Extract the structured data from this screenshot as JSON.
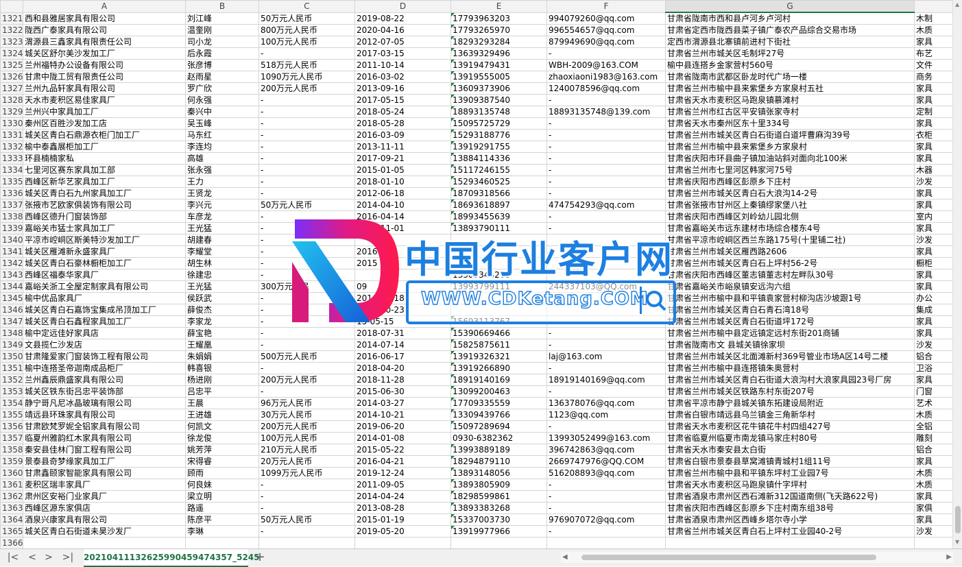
{
  "columns": [
    "A",
    "B",
    "C",
    "D",
    "E",
    "F",
    "G",
    ""
  ],
  "rows": [
    {
      "n": "1321",
      "a": "西和县雅居家具有限公司",
      "b": "刘江峰",
      "c": "50万元人民币",
      "d": "2019-08-22",
      "e": "17793963203",
      "f": "994079260@qq.com",
      "g": "甘肃省陇南市西和县卢河乡卢河村",
      "h": "木制"
    },
    {
      "n": "1322",
      "a": "陇西广泰家具有限公司",
      "b": "温奎刚",
      "c": "800万元人民币",
      "d": "2020-04-16",
      "e": "17793265970",
      "f": "996554657@qq.com",
      "g": "甘肃省定西市陇西县菜子镇广泰农产品综合交易市场",
      "h": "木质"
    },
    {
      "n": "1323",
      "a": "渭源县三鑫家具有限责任公司",
      "b": "司小龙",
      "c": "100万元人民币",
      "d": "2012-07-05",
      "e": "18293293284",
      "f": "879949690@qq.com",
      "g": "定西市渭源县北寨镇前进村下街社",
      "h": "家具"
    },
    {
      "n": "1324",
      "a": "城关区舒尔美沙发加工厂",
      "b": "后永霞",
      "c": "-",
      "d": "2017-03-15",
      "e": "13639329496",
      "f": "-",
      "g": "甘肃省兰州市城关区毛制坪27号",
      "h": "布艺"
    },
    {
      "n": "1325",
      "a": "兰州福特办公设备有限公司",
      "b": "张彦博",
      "c": "518万元人民币",
      "d": "2011-10-14",
      "e": "13919479431",
      "f": "WBH-2009@163.COM",
      "g": "榆中县连搭乡金家营村560号",
      "h": "文件"
    },
    {
      "n": "1326",
      "a": "甘肃中陇工贸有限责任公司",
      "b": "赵雨星",
      "c": "1090万元人民币",
      "d": "2016-03-02",
      "e": "13919555005",
      "f": "zhaoxiaoni1983@163.com",
      "g": "甘肃省陇南市武都区卧龙时代广场一楼",
      "h": "商务"
    },
    {
      "n": "1327",
      "a": "兰州九品轩家具有限公司",
      "b": "罗广欣",
      "c": "200万元人民币",
      "d": "2013-09-16",
      "e": "13609373906",
      "f": "1240078596@qq.com",
      "g": "甘肃省兰州市榆中县来紫堡乡方家泉村五社",
      "h": "家具"
    },
    {
      "n": "1328",
      "a": "天水市麦积区易佳家具厂",
      "b": "何永强",
      "c": "-",
      "d": "2017-05-15",
      "e": "13909387540",
      "f": "-",
      "g": "甘肃省天水市麦积区马跑泉镇慕滩村",
      "h": "家具"
    },
    {
      "n": "1329",
      "a": "兰州兴中家具加工厂",
      "b": "秦兴中",
      "c": "-",
      "d": "2018-05-24",
      "e": "18893135748",
      "f": "18893135748@139.com",
      "g": "甘肃省兰州市红古区平安镇张家寺村",
      "h": "定制"
    },
    {
      "n": "1330",
      "a": "秦州区百胜沙发加工店",
      "b": "吴玉峰",
      "c": "-",
      "d": "2018-05-28",
      "e": "15095725729",
      "f": "-",
      "g": "甘肃省天水市秦州区东十里334号",
      "h": "家具"
    },
    {
      "n": "1331",
      "a": "城关区青白石鼎源衣柜门加工厂",
      "b": "马东红",
      "c": "-",
      "d": "2016-03-09",
      "e": "15293188776",
      "f": "-",
      "g": "甘肃省兰州市城关区青白石街道白道坪曹麻沟39号",
      "h": "衣柜"
    },
    {
      "n": "1332",
      "a": "榆中泰鑫展柜加工厂",
      "b": "李连均",
      "c": "-",
      "d": "2013-11-11",
      "e": "13919291755",
      "f": "-",
      "g": "甘肃省兰州市榆中县来紫堡乡方家泉村",
      "h": "家具"
    },
    {
      "n": "1333",
      "a": "环县楠楠家私",
      "b": "高雄",
      "c": "-",
      "d": "2017-09-21",
      "e": "13884114336",
      "f": "-",
      "g": "甘肃省庆阳市环县曲子镇加油站斜对面向北100米",
      "h": "家具"
    },
    {
      "n": "1334",
      "a": "七里河区赛东家具加工部",
      "b": "张永强",
      "c": "-",
      "d": "2015-01-05",
      "e": "15117246155",
      "f": "-",
      "g": "甘肃省兰州市七里河区韩家河75号",
      "h": "木器"
    },
    {
      "n": "1335",
      "a": "西峰区新华艺家具加工厂",
      "b": "王力",
      "c": "-",
      "d": "2018-01-10",
      "e": "15293460525",
      "f": "-",
      "g": "甘肃省庆阳市西峰区彭原乡下庄村",
      "h": "沙发"
    },
    {
      "n": "1336",
      "a": "城关区青白石九州家具加工厂",
      "b": "王贤龙",
      "c": "-",
      "d": "2012-06-18",
      "e": "18709318566",
      "f": "-",
      "g": "甘肃省兰州市城关区青白石大浪沟14-2号",
      "h": "家具"
    },
    {
      "n": "1337",
      "a": "张掖市艺欧家俱装饰有限公司",
      "b": "李兴元",
      "c": "50万元人民币",
      "d": "2014-04-10",
      "e": "18693618897",
      "f": "474754293@qq.com",
      "g": "甘肃省张掖市甘州区上秦镇缪家堡八社",
      "h": "家具"
    },
    {
      "n": "1338",
      "a": "西峰区德升门窗装饰部",
      "b": "车彦龙",
      "c": "-",
      "d": "2016-04-14",
      "e": "18993455639",
      "f": "-",
      "g": "甘肃省庆阳市西峰区刘岭幼儿园北侧",
      "h": "室内"
    },
    {
      "n": "1339",
      "a": "嘉峪关市猛士家具加工厂",
      "b": "王光猛",
      "c": "-",
      "d": "2018-11-01",
      "e": "13893790111",
      "f": "-",
      "g": "甘肃省嘉峪关市远东建材市场综合楼东4号",
      "h": "家具"
    },
    {
      "n": "1340",
      "a": "平凉市崆峒区斯美特沙发加工厂",
      "b": "胡建春",
      "c": "-",
      "d": "",
      "e": "",
      "f": "",
      "g": "甘肃省平凉市崆峒区西兰东路175号(十里铺二社)",
      "h": "沙发"
    },
    {
      "n": "1341",
      "a": "城关区雁滩新永盛家具厂",
      "b": "李耀堂",
      "c": "-",
      "d": "2016",
      "e": "",
      "f": "",
      "g": "甘肃省兰州市城关区雁西路2606",
      "h": "家具"
    },
    {
      "n": "1342",
      "a": "城关区青白石豪林橱柜加工厂",
      "b": "胡生林",
      "c": "-",
      "d": "2015",
      "e": "",
      "f": "",
      "g": "甘肃省兰州市城关区青白石上坪村56-2号",
      "h": "橱柜"
    },
    {
      "n": "1343",
      "a": "西峰区福泰华家具厂",
      "b": "徐建忠",
      "c": "-",
      "d": "",
      "e": "13309344268",
      "f": "",
      "g": "甘肃省庆阳市西峰区董志镇董志村左畔队30号",
      "h": "家具"
    },
    {
      "n": "1344",
      "a": "嘉峪关浙工全屋定制家具有限公司",
      "b": "王光猛",
      "c": "300万元人民",
      "d": "09",
      "e": "13993799111",
      "f": "244337103@QQ.com",
      "g": "甘肃省嘉峪关市峪泉镇安远沟六组",
      "h": "家具"
    },
    {
      "n": "1345",
      "a": "榆中优品家具厂",
      "b": "侯跃武",
      "c": "-",
      "d": "2016-01-18",
      "e": "",
      "f": "",
      "g": "甘肃省兰州市榆中县和平镇袁家营村柳沟店沙坡跟1号",
      "h": "办公"
    },
    {
      "n": "1346",
      "a": "城关区青白石嘉饰宝集成吊顶加工厂",
      "b": "薛俊杰",
      "c": "-",
      "d": "2015-10-23",
      "e": "",
      "f": "",
      "g": "甘肃省兰州市城关区青白石青石湾18号",
      "h": "集成"
    },
    {
      "n": "1347",
      "a": "城关区青白石鑫程家具加工厂",
      "b": "李家龙",
      "c": "-",
      "d": "15-05-15",
      "e": "15693113767",
      "f": "",
      "g": "甘肃省兰州市城关区青白石街道坪172号",
      "h": "家具"
    },
    {
      "n": "1348",
      "a": "榆中定远佳好家具店",
      "b": "薛宝艳",
      "c": "-",
      "d": "2018-07-31",
      "e": "15390669466",
      "f": "-",
      "g": "甘肃省兰州市榆中县定远镇定远村东街201商铺",
      "h": "家具"
    },
    {
      "n": "1349",
      "a": "文县揽仁沙发店",
      "b": "王耀凰",
      "c": "-",
      "d": "2014-07-14",
      "e": "15825875611",
      "f": "-",
      "g": "甘肃省陇南市文  县城关镇徐家坝",
      "h": "沙发"
    },
    {
      "n": "1350",
      "a": "甘肃隆爱家门窗装饰工程有限公司",
      "b": "朱娟娟",
      "c": "500万元人民币",
      "d": "2016-06-17",
      "e": "13919326321",
      "f": "laj@163.com",
      "g": "甘肃省兰州市城关区北面滩新村369号管业市场A区14号二楼",
      "h": "铝合"
    },
    {
      "n": "1351",
      "a": "榆中连搭圣帝迦南成品柜厂",
      "b": "韩喜银",
      "c": "-",
      "d": "2018-04-20",
      "e": "13919266890",
      "f": "-",
      "g": "甘肃省兰州市榆中县连搭镇朱奥营村",
      "h": "卫浴"
    },
    {
      "n": "1352",
      "a": "兰州鑫辰鼎盛家具有限公司",
      "b": "杨进刚",
      "c": "200万元人民币",
      "d": "2018-11-28",
      "e": "18919140169",
      "f": "18919140169@qq.com",
      "g": "甘肃省兰州市城关区青白石街道大浪沟村大浪家具园23号厂房",
      "h": "家具"
    },
    {
      "n": "1353",
      "a": "城关区铁东街吕忠平装饰部",
      "b": "吕忠平",
      "c": "-",
      "d": "2015-06-30",
      "e": "13099200463",
      "f": "-",
      "g": "甘肃省兰州市城关区铁路东村东街207号",
      "h": "门窗"
    },
    {
      "n": "1354",
      "a": "静宁哥凡尼冰晶玻璃有限公司",
      "b": "王晨",
      "c": "96万元人民币",
      "d": "2014-03-27",
      "e": "17709335559",
      "f": "136378076@qq.com",
      "g": "甘肃省平凉市静宁县城关镇东拓建设局附近",
      "h": "艺术"
    },
    {
      "n": "1355",
      "a": "靖远县环珠家具有限公司",
      "b": "王进雄",
      "c": "30万元人民币",
      "d": "2014-10-21",
      "e": "13309439766",
      "f": "1123@qq.com",
      "g": "甘肃省白银市靖远县乌兰镇金三角新华村",
      "h": "木质"
    },
    {
      "n": "1356",
      "a": "甘肃欧梵罗妮全铝家具有限公司",
      "b": "何凯文",
      "c": "200万元人民币",
      "d": "2019-06-20",
      "e": "15097289694",
      "f": "-",
      "g": "甘肃省天水市麦积区花牛镇花牛村四组427号",
      "h": "全铝"
    },
    {
      "n": "1357",
      "a": "临夏州雅韵红木家具有限公司",
      "b": "徐龙俊",
      "c": "100万元人民币",
      "d": "2014-01-08",
      "e": "0930-6382362",
      "f": "13993052499@163.com",
      "g": "甘肃省临夏州临夏市南龙镇马家庄村80号",
      "h": "雕刻"
    },
    {
      "n": "1358",
      "a": "秦安县佳林门窗工程有限公司",
      "b": "姚芳萍",
      "c": "210万元人民币",
      "d": "2015-05-22",
      "e": "13993889189",
      "f": "396742863@qq.com",
      "g": "甘肃省天水市秦安县太白街",
      "h": "铝合"
    },
    {
      "n": "1359",
      "a": "景泰县奇梦缘家具加工厂",
      "b": "宋得睿",
      "c": "20万元人民币",
      "d": "2016-04-21",
      "e": "18294879110",
      "f": "2669747976@QQ.COM",
      "g": "甘肃省白银市景泰县草窝滩镇青城村1组11号",
      "h": "家具"
    },
    {
      "n": "1360",
      "a": "甘肃鑫颐家智能家具有限公司",
      "b": "顾雨",
      "c": "1099万元人民币",
      "d": "2019-12-24",
      "e": "13893148056",
      "f": "516208893@qq.com",
      "g": "甘肃省兰州市榆中县和平镇东坪村工业园7号",
      "h": "木质"
    },
    {
      "n": "1361",
      "a": "麦积区瑞丰家具厂",
      "b": "何良妹",
      "c": "-",
      "d": "2011-09-05",
      "e": "13893805909",
      "f": "-",
      "g": "甘肃省天水市麦积区马跑泉镇什字坪村",
      "h": "木质"
    },
    {
      "n": "1362",
      "a": "肃州区安裕门业家具厂",
      "b": "梁立明",
      "c": "-",
      "d": "2014-04-24",
      "e": "18298599861",
      "f": "-",
      "g": "甘肃省酒泉市肃州区西石滩新312国道南侧(飞天路622号)",
      "h": "家具"
    },
    {
      "n": "1363",
      "a": "西峰区源东家俱店",
      "b": "路遥",
      "c": "-",
      "d": "2013-08-28",
      "e": "13893383268",
      "f": "-",
      "g": "甘肃省庆阳市西峰区彭原乡下庄村南东组38号",
      "h": "家俱"
    },
    {
      "n": "1364",
      "a": "酒泉兴康家具有限公司",
      "b": "陈彦平",
      "c": "50万元人民币",
      "d": "2015-01-19",
      "e": "15337003730",
      "f": "976907072@qq.com",
      "g": "甘肃省酒泉市肃州区西峰乡塔尔寺小学",
      "h": "家具"
    },
    {
      "n": "1365",
      "a": "城关区青白石街道未昊沙发厂",
      "b": "李琳",
      "c": "-",
      "d": "2019-05-20",
      "e": "13919977966",
      "f": "-",
      "g": "甘肃省兰州市城关区青白石上坪村工业园40-2号",
      "h": "沙发"
    },
    {
      "n": "1366",
      "a": "",
      "b": "",
      "c": "",
      "d": "",
      "e": "",
      "f": "",
      "g": "",
      "h": ""
    }
  ],
  "tab": {
    "sheet_name": "20210411132625990459474357_5245",
    "add_label": "+"
  },
  "nav": {
    "first": "|<",
    "prev": "<",
    "next": ">",
    "last": ">|"
  },
  "watermark": {
    "title": "中国行业客户网",
    "url": "WWW.CDKetang.COM"
  },
  "colors": {
    "accent": "#217346",
    "watermark_blue": "#1d7fe0"
  }
}
